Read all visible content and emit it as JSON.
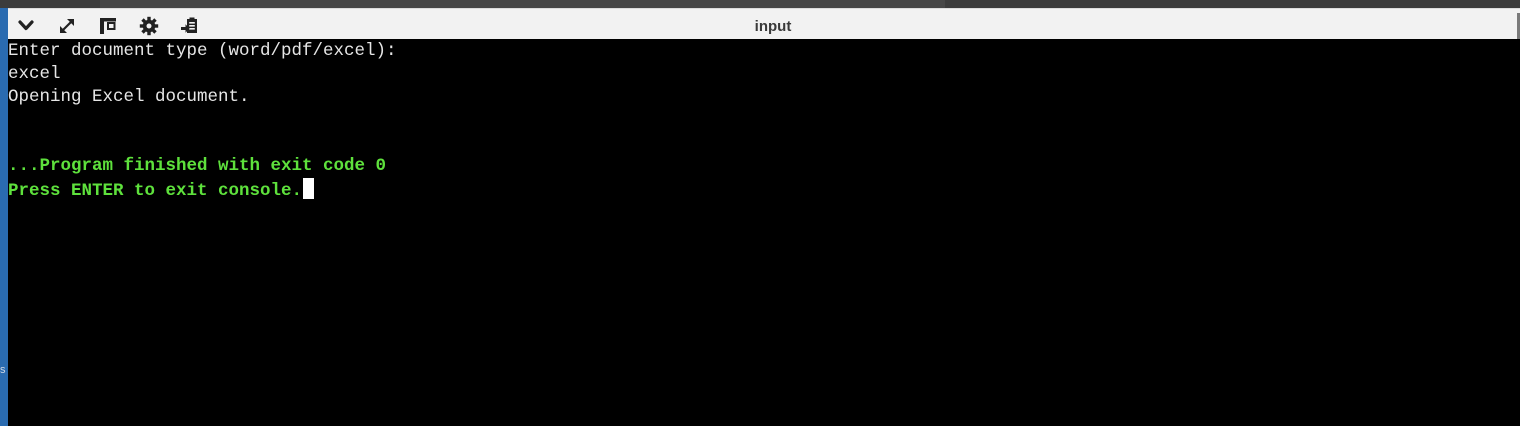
{
  "window": {
    "title": "input"
  },
  "toolbar": {
    "buttons": [
      {
        "name": "collapse-button",
        "icon": "chevron-down-icon"
      },
      {
        "name": "maximize-button",
        "icon": "expand-arrows-icon"
      },
      {
        "name": "layout-button",
        "icon": "layout-panel-icon"
      },
      {
        "name": "settings-button",
        "icon": "gear-icon"
      },
      {
        "name": "copy-button",
        "icon": "clipboard-copy-icon"
      }
    ]
  },
  "console": {
    "lines": [
      {
        "kind": "out",
        "text": "Enter document type (word/pdf/excel):"
      },
      {
        "kind": "out",
        "text": "excel"
      },
      {
        "kind": "out",
        "text": "Opening Excel document."
      },
      {
        "kind": "out",
        "text": ""
      },
      {
        "kind": "out",
        "text": ""
      },
      {
        "kind": "status",
        "text": "...Program finished with exit code 0"
      },
      {
        "kind": "status",
        "text": "Press ENTER to exit console."
      }
    ]
  },
  "colors": {
    "console_bg": "#000000",
    "console_text": "#e6e6e6",
    "status_text": "#5ee13c",
    "toolbar_bg": "#f2f2f2",
    "left_accent": "#2a6bb0"
  }
}
